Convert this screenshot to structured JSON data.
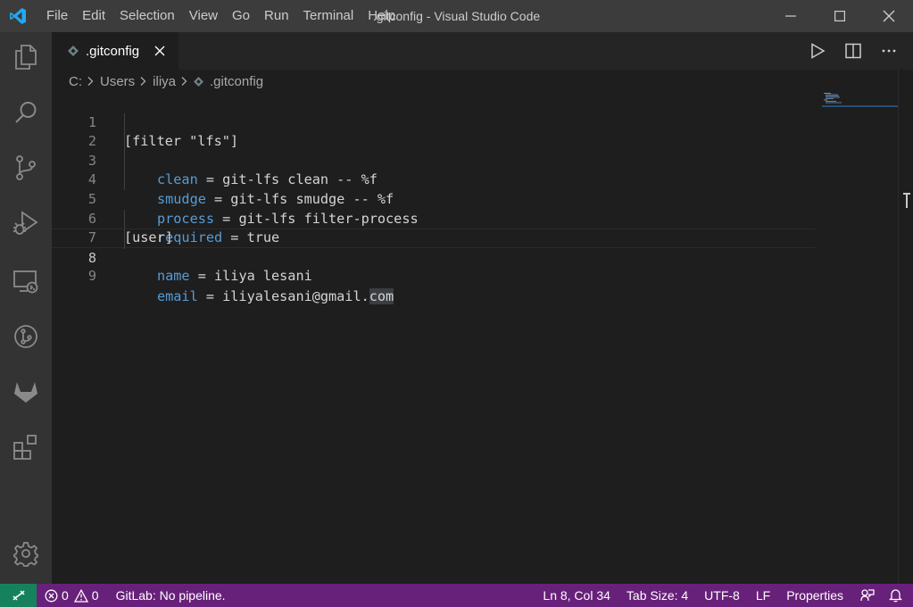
{
  "window": {
    "title": ".gitconfig - Visual Studio Code",
    "menu": [
      "File",
      "Edit",
      "Selection",
      "View",
      "Go",
      "Run",
      "Terminal",
      "Help"
    ]
  },
  "activity_bar": {
    "items": [
      "explorer",
      "search",
      "source-control",
      "run-and-debug",
      "remote-explorer",
      "git-graph",
      "gitlab",
      "extensions"
    ],
    "bottom": [
      "manage"
    ]
  },
  "tabs": [
    {
      "label": ".gitconfig",
      "active": true
    }
  ],
  "breadcrumb": [
    "C:",
    "Users",
    "iliya",
    ".gitconfig"
  ],
  "editor": {
    "lines": [
      {
        "n": "1",
        "text": "[filter \"lfs\"]"
      },
      {
        "n": "2",
        "key": "clean",
        "rest": " = git-lfs clean -- %f"
      },
      {
        "n": "3",
        "key": "smudge",
        "rest": " = git-lfs smudge -- %f"
      },
      {
        "n": "4",
        "key": "process",
        "rest": " = git-lfs filter-process"
      },
      {
        "n": "5",
        "key": "required",
        "rest": " = true"
      },
      {
        "n": "6",
        "text": "[user]"
      },
      {
        "n": "7",
        "key": "name",
        "rest": " = iliya lesani"
      },
      {
        "n": "8",
        "key": "email",
        "rest_plain": " = iliyalesani@gmail.",
        "rest_sel": "com"
      },
      {
        "n": "9",
        "text": ""
      }
    ]
  },
  "statusbar": {
    "errors": "0",
    "warnings": "0",
    "gitlab": "GitLab: No pipeline.",
    "cursor": "Ln 8, Col 34",
    "tab_size": "Tab Size: 4",
    "encoding": "UTF-8",
    "eol": "LF",
    "language": "Properties"
  },
  "colors": {
    "titlebar": "#3c3c3c",
    "activitybar": "#333333",
    "editor": "#1e1e1e",
    "statusbar": "#68217a",
    "remote": "#16825d",
    "keyword": "#569cd6"
  }
}
